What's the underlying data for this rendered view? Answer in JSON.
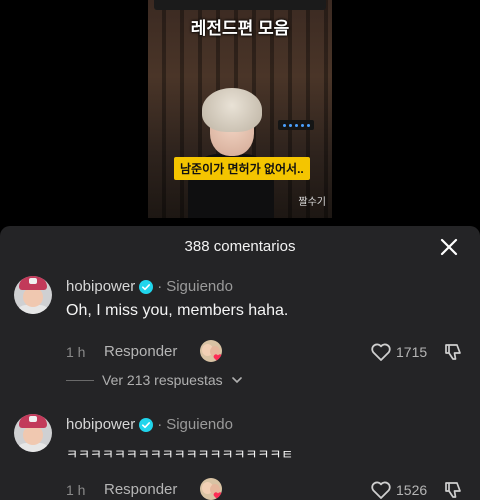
{
  "video": {
    "title": "레전드편 모음",
    "subtitle": "남준이가 면허가 없어서..",
    "watermark": "짤수기"
  },
  "comments_sheet": {
    "title": "388 comentarios",
    "close_icon": "close-icon",
    "comments": [
      {
        "username": "hobipower",
        "verified_icon": "verified-badge-icon",
        "separator": "·",
        "status": "Siguiendo",
        "text": "Oh, I miss you, members haha.",
        "time": "1 h",
        "reply_label": "Responder",
        "likes": "1715",
        "view_replies": "Ver 213 respuestas"
      },
      {
        "username": "hobipower",
        "verified_icon": "verified-badge-icon",
        "separator": "·",
        "status": "Siguiendo",
        "text": "ㅋㅋㅋㅋㅋㅋㅋㅋㅋㅋㅋㅋㅋㅋㅋㅋㅋㅋㅌ",
        "time": "1 h",
        "reply_label": "Responder",
        "likes": "1526"
      }
    ]
  },
  "colors": {
    "sheet_bg": "#242426",
    "verified": "#20d5ec",
    "subtitle_bg": "#f4c500"
  }
}
